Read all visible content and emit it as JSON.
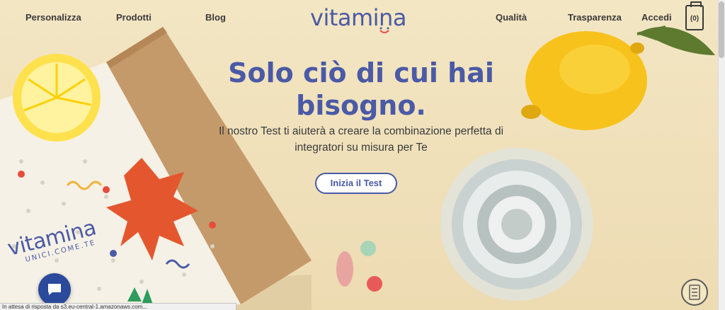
{
  "nav": {
    "left": [
      "Personalizza",
      "Prodotti",
      "Blog"
    ],
    "right": [
      "Qualità",
      "Trasparenza",
      "Accedi"
    ],
    "cart_count": "(0)"
  },
  "logo": {
    "text": "vitamina",
    "brand_color": "#4a5aa6",
    "accent_color": "#e74c5c"
  },
  "hero": {
    "headline_line1": "Solo ciò di cui hai",
    "headline_line2": "bisogno.",
    "subtitle_line1": "Il nostro Test ti aiuterà a creare la combinazione perfetta di",
    "subtitle_line2": "integratori su misura per Te",
    "cta_label": "Inizia il Test"
  },
  "box": {
    "brand": "vitamina",
    "tagline": "UNICI.COME.TE"
  },
  "status_bar": "In attesa di risposta da s3.eu-central-1.amazonaws.com...",
  "icons": {
    "chat": "chat-bubble-icon",
    "cart": "jar-cart-icon",
    "checklist": "checklist-icon"
  }
}
